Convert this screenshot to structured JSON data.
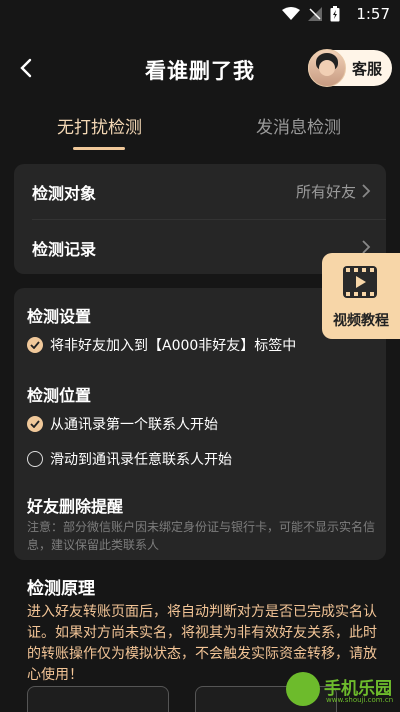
{
  "status": {
    "time": "1:57"
  },
  "header": {
    "title": "看谁删了我",
    "support_label": "客服"
  },
  "tabs": [
    {
      "label": "无打扰检测"
    },
    {
      "label": "发消息检测"
    }
  ],
  "card1": {
    "target_label": "检测对象",
    "target_value": "所有好友",
    "records_label": "检测记录"
  },
  "float_button": {
    "label": "视频教程"
  },
  "settings": {
    "title": "检测设置",
    "option": "将非好友加入到【A000非好友】标签中"
  },
  "position": {
    "title": "检测位置",
    "options": [
      {
        "label": "从通讯录第一个联系人开始",
        "checked": true
      },
      {
        "label": "滑动到通讯录任意联系人开始",
        "checked": false
      }
    ]
  },
  "reminder": {
    "title": "好友删除提醒",
    "note": "注意：部分微信账户因未绑定身份证与银行卡，可能不显示实名信息，建议保留此类联系人"
  },
  "principle": {
    "title": "检测原理",
    "text": "进入好友转账页面后，将自动判断对方是否已完成实名认证。如果对方尚未实名，将视其为非有效好友关系，此时的转账操作仅为模拟状态，不会触发实际资金转移，请放心使用！"
  },
  "watermark": {
    "text": "手机乐园",
    "sub": "www.shouji.com.cn"
  },
  "colors": {
    "accent": "#f0c89a",
    "background": "#161616",
    "card": "#262626"
  }
}
